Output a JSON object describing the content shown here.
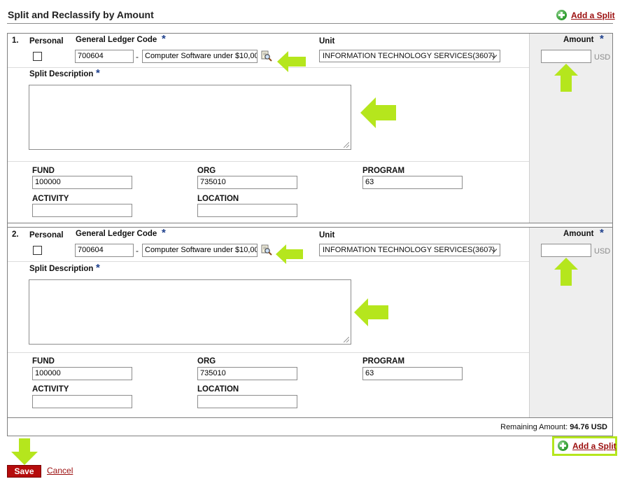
{
  "header": {
    "title": "Split and Reclassify by Amount",
    "add_split_label": "Add a Split"
  },
  "labels": {
    "personal": "Personal",
    "gl_code": "General Ledger Code",
    "unit": "Unit",
    "amount": "Amount",
    "split_description": "Split Description",
    "fund": "FUND",
    "org": "ORG",
    "program": "PROGRAM",
    "activity": "ACTIVITY",
    "location": "LOCATION",
    "currency": "USD",
    "required_mark": "*",
    "dash": "-"
  },
  "splits": [
    {
      "number": "1.",
      "gl_code": "700604",
      "gl_description": "Computer Software under $10,00",
      "unit": "INFORMATION TECHNOLOGY SERVICES(3607)",
      "amount": "",
      "description": "",
      "fund": "100000",
      "org": "735010",
      "program": "63",
      "activity": "",
      "location": ""
    },
    {
      "number": "2.",
      "gl_code": "700604",
      "gl_description": "Computer Software under $10,00",
      "unit": "INFORMATION TECHNOLOGY SERVICES(3607)",
      "amount": "",
      "description": "",
      "fund": "100000",
      "org": "735010",
      "program": "63",
      "activity": "",
      "location": ""
    }
  ],
  "footer": {
    "remaining_label": "Remaining Amount:",
    "remaining_value": "94.76 USD",
    "add_split_label": "Add a Split",
    "save_label": "Save",
    "cancel_label": "Cancel"
  },
  "colors": {
    "brand_red": "#b50c0c",
    "link_red": "#9b0d0d",
    "arrow_green": "#b5e61d",
    "required_star": "#1d3f8c"
  },
  "icons": [
    "plus-circle-icon",
    "lookup-magnifier-icon",
    "chevron-down-icon",
    "annotation-arrow-icon"
  ]
}
